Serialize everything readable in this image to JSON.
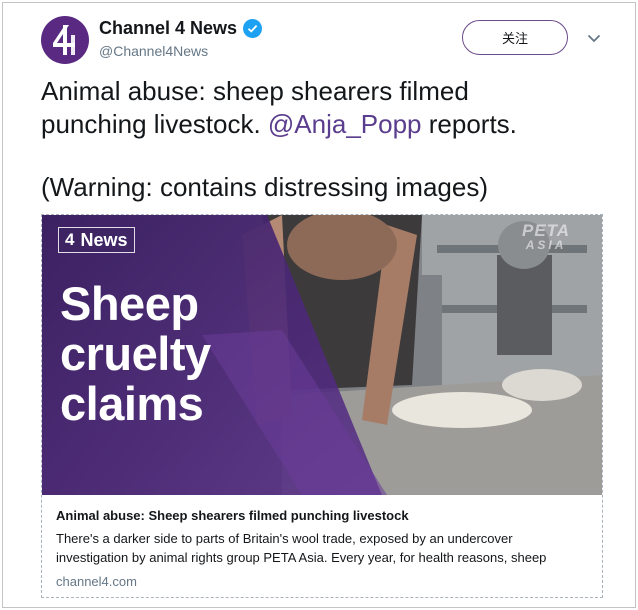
{
  "account": {
    "display_name": "Channel 4 News",
    "handle": "@Channel4News",
    "avatar_icon": "channel4-logo-icon",
    "verified_icon": "verified-badge-icon",
    "brand_color": "#5a2a82"
  },
  "header": {
    "follow_label": "关注",
    "menu_icon": "chevron-down-icon"
  },
  "tweet": {
    "line1": "Animal abuse: sheep shearers filmed",
    "line2_prefix": "punching livestock. ",
    "mention": "@Anja_Popp",
    "line2_suffix": " reports.",
    "line3": "(Warning: contains distressing images)",
    "mention_color": "#5b3d8e"
  },
  "card": {
    "image": {
      "badge_glyph": "4",
      "badge_label": "News",
      "watermark_line1": "PETA",
      "watermark_line2": "ASIA",
      "overlay_line1": "Sheep",
      "overlay_line2": "cruelty",
      "overlay_line3": "claims"
    },
    "title": "Animal abuse: Sheep shearers filmed punching livestock",
    "description_line1": "There's a darker side to parts of Britain's wool trade, exposed by an undercover",
    "description_line2": "investigation by animal rights group PETA Asia. Every year, for health reasons, sheep",
    "domain": "channel4.com"
  }
}
